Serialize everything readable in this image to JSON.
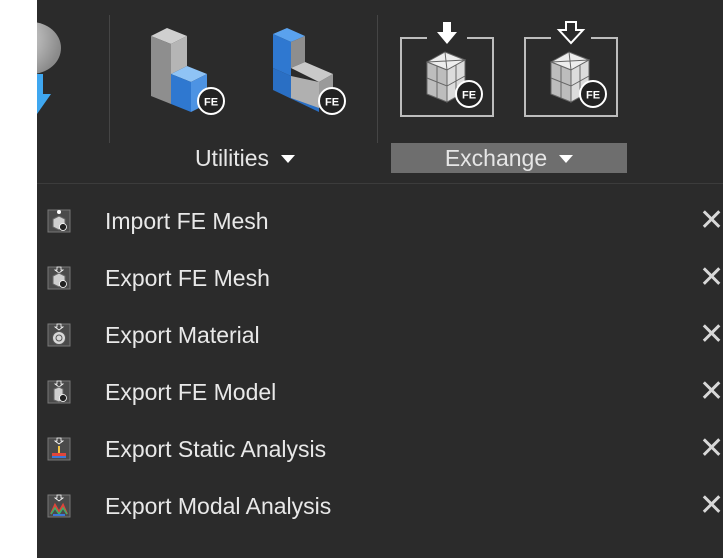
{
  "ribbon": {
    "groups": [
      {
        "label": "Utilities",
        "active": false
      },
      {
        "label": "Exchange",
        "active": true
      }
    ],
    "fe_badge": "FE",
    "icons": [
      "sphere-arrow-icon",
      "fe-block-icon",
      "fe-lshape-icon",
      "import-fe-icon",
      "export-fe-icon"
    ]
  },
  "menu": {
    "items": [
      {
        "label": "Import FE Mesh",
        "icon": "import-fe-mesh-icon"
      },
      {
        "label": "Export FE Mesh",
        "icon": "export-fe-mesh-icon"
      },
      {
        "label": "Export Material",
        "icon": "export-material-icon"
      },
      {
        "label": "Export FE Model",
        "icon": "export-fe-model-icon"
      },
      {
        "label": "Export Static Analysis",
        "icon": "export-static-analysis-icon"
      },
      {
        "label": "Export Modal Analysis",
        "icon": "export-modal-analysis-icon"
      }
    ],
    "close_glyph": "✕"
  },
  "colors": {
    "background": "#2b2b2b",
    "active_group": "#6e6e6e",
    "accent_blue": "#3a8ee6",
    "text": "#e8e8e8"
  }
}
